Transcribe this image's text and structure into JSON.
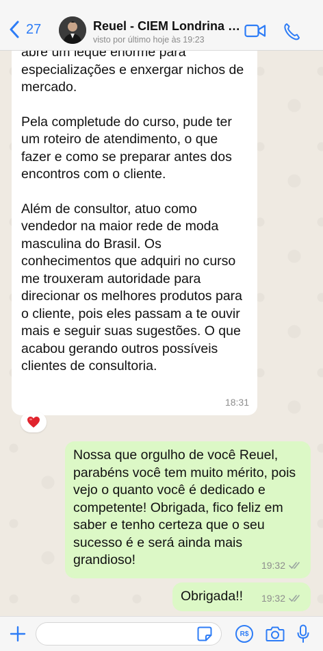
{
  "header": {
    "back_count": "27",
    "contact_name": "Reuel - CIEM Londrina P...",
    "contact_status": "visto por último hoje às 19:23"
  },
  "messages": [
    {
      "direction": "incoming",
      "paragraphs": [
        "abre um leque enorme para especializações e enxergar nichos de mercado.",
        "Pela completude do curso, pude ter um roteiro de atendimento, o que fazer e como se preparar antes dos encontros com o cliente.",
        "Além de consultor, atuo como vendedor na maior rede de moda masculina do Brasil. Os conhecimentos que adquiri no curso me trouxeram autoridade para direcionar os melhores produtos para o cliente, pois eles passam a te ouvir mais e seguir suas sugestões. O que acabou gerando outros possíveis clientes de consultoria."
      ],
      "time": "18:31",
      "reaction": "❤️"
    },
    {
      "direction": "outgoing",
      "text": "Nossa que orgulho de você Reuel, parabéns você tem muito mérito, pois vejo o quanto você é dedicado e competente! Obrigada, fico feliz em saber e tenho certeza que o seu sucesso é e será ainda mais grandioso!",
      "time": "19:32",
      "status": "read"
    },
    {
      "direction": "outgoing",
      "text": "Obrigada!!",
      "time": "19:32",
      "status": "read"
    }
  ],
  "input": {
    "placeholder": "",
    "pix_label": "R$"
  },
  "colors": {
    "accent": "#2d7cf6",
    "incoming_bubble": "#ffffff",
    "outgoing_bubble": "#dcf8c6",
    "chat_background": "#efeae2"
  },
  "icons": [
    "chevron-left-icon",
    "avatar",
    "video-camera-icon",
    "phone-icon",
    "plus-icon",
    "sticker-icon",
    "pix-icon",
    "camera-icon",
    "microphone-icon",
    "double-check-icon",
    "heart-icon"
  ]
}
